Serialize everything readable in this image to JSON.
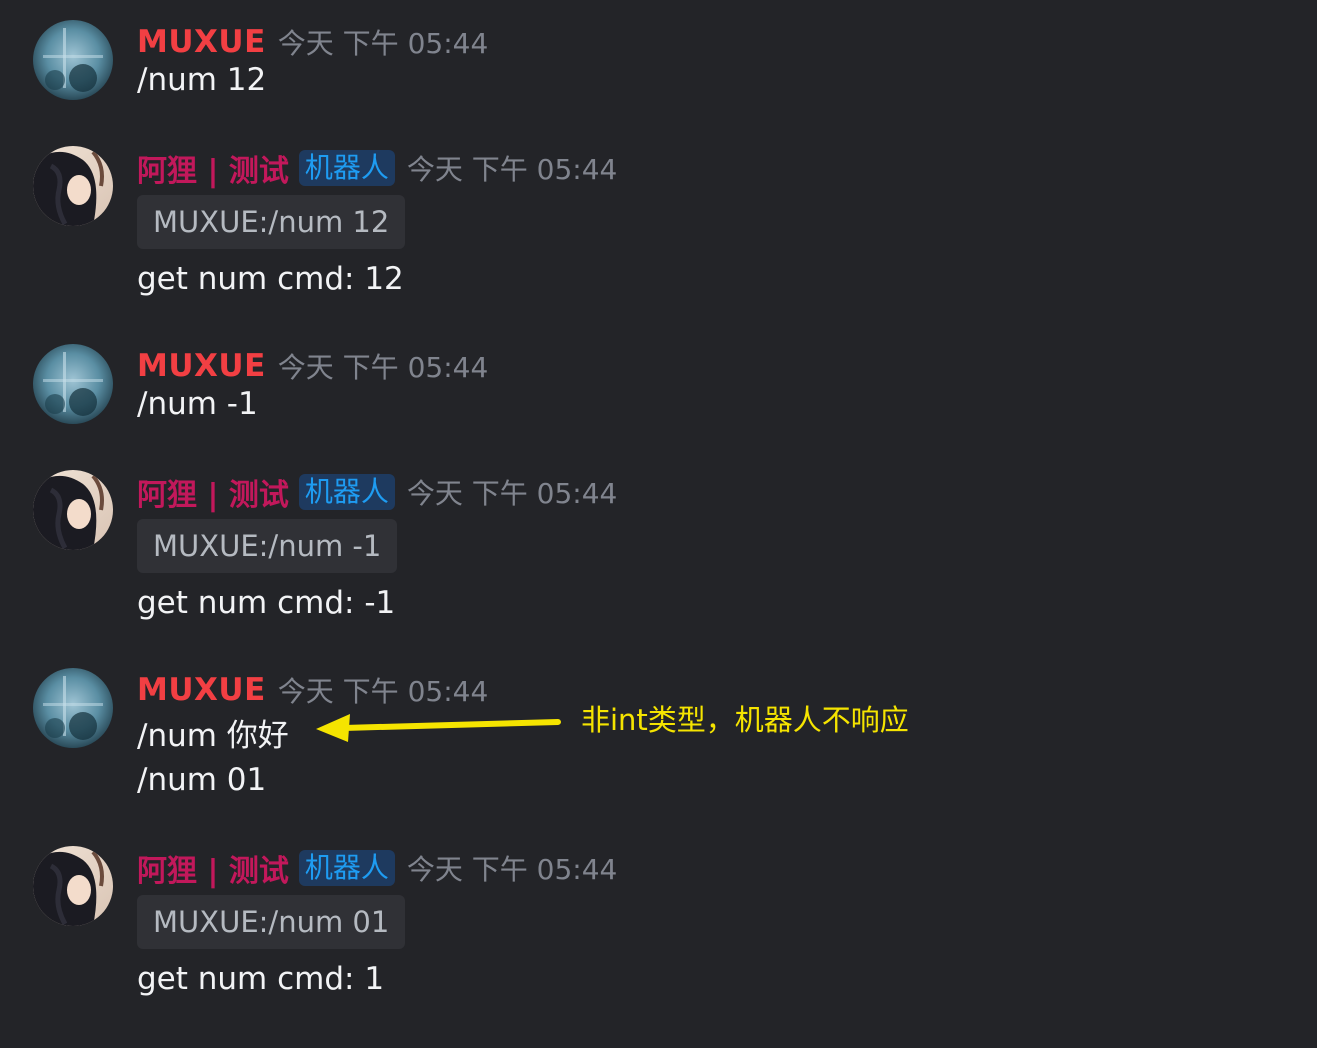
{
  "colors": {
    "background": "#232428",
    "user_name": "#f23f43",
    "bot_name": "#c2185b",
    "bot_tag_text": "#1e9cf2",
    "bot_tag_bg": "#1e3a5f",
    "timestamp": "#80848e",
    "quote_bg": "#303136",
    "annotation": "#f5e400"
  },
  "messages": [
    {
      "author": "MUXUE",
      "timestamp": "今天 下午 05:44",
      "lines": [
        "/num 12"
      ]
    },
    {
      "author": "阿狸 | 测试",
      "bot_tag": "机器人",
      "timestamp": "今天 下午 05:44",
      "quote": "MUXUE:/num 12",
      "lines": [
        "get num cmd: 12"
      ]
    },
    {
      "author": "MUXUE",
      "timestamp": "今天 下午 05:44",
      "lines": [
        "/num -1"
      ]
    },
    {
      "author": "阿狸 | 测试",
      "bot_tag": "机器人",
      "timestamp": "今天 下午 05:44",
      "quote": "MUXUE:/num -1",
      "lines": [
        "get num cmd: -1"
      ]
    },
    {
      "author": "MUXUE",
      "timestamp": "今天 下午 05:44",
      "lines": [
        "/num 你好",
        "/num 01"
      ]
    },
    {
      "author": "阿狸 | 测试",
      "bot_tag": "机器人",
      "timestamp": "今天 下午 05:44",
      "quote": "MUXUE:/num 01",
      "lines": [
        "get num cmd: 1"
      ]
    }
  ],
  "annotation": {
    "text": "非int类型，机器人不响应",
    "icon": "arrow-left-icon"
  }
}
